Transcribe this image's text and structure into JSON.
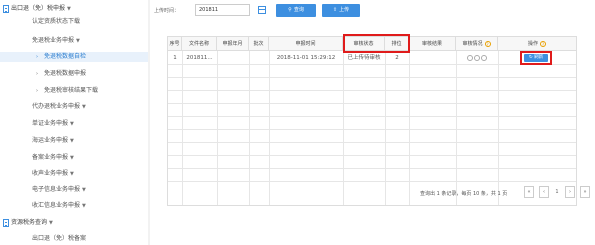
{
  "sidebar": {
    "section_export": "出口退（免）税申报",
    "items": [
      {
        "label": "认定资质状态下载"
      },
      {
        "label": "免退税业务申报"
      },
      {
        "label": "免退税数据自检"
      },
      {
        "label": "免退税数据申报"
      },
      {
        "label": "免退税审核结果下载"
      },
      {
        "label": "代办退税业务申报"
      },
      {
        "label": "单证业务申报"
      },
      {
        "label": "海运业务申报"
      },
      {
        "label": "备案业务申报"
      },
      {
        "label": "收声业务申报"
      },
      {
        "label": "电子信息业务申报"
      },
      {
        "label": "收汇信息业务申报"
      }
    ],
    "section_query": "资源税务查询",
    "last_item": "出口退（免）税备案"
  },
  "search": {
    "label": "上传时间：",
    "value": "201811"
  },
  "buttons": {
    "query": "查询",
    "upload": "上传"
  },
  "table": {
    "headers": {
      "seq": "序号",
      "filename": "文件名称",
      "month": "申报年月",
      "batch": "批次",
      "upload_time": "申报时间",
      "status": "审核状态",
      "queue": "排位",
      "result": "审核结果",
      "detail": "审核情况",
      "action": "操作"
    },
    "rows": [
      {
        "seq": "1",
        "filename": "201811...",
        "month": "",
        "batch": "",
        "upload_time": "2018-11-01 15:29:12",
        "status": "已上传待审核",
        "queue": "2",
        "result": "",
        "action": "刷新"
      }
    ]
  },
  "pager": {
    "summary": "查询出 1 条记录，每页 10 条，共 1 页",
    "current": "1"
  },
  "colors": {
    "accent": "#3d8fe0",
    "highlight": "#e01b1b",
    "help": "#e8a000"
  }
}
